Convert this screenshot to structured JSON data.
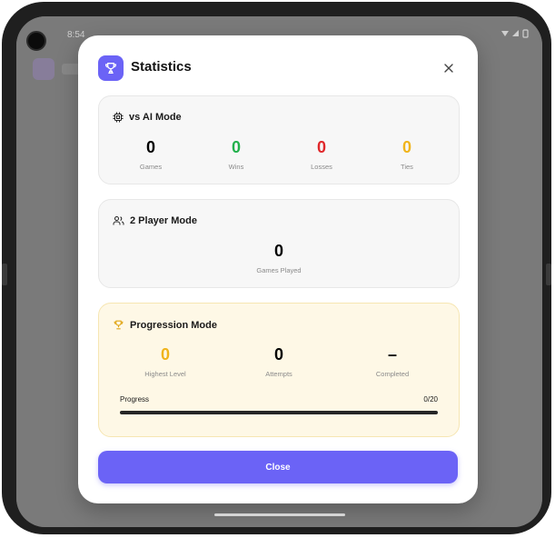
{
  "status_bar": {
    "time": "8:54",
    "icons": "▾ ▮"
  },
  "dialog": {
    "title": "Statistics",
    "close_button_label": "Close"
  },
  "vs_ai": {
    "title": "vs AI Mode",
    "stats": [
      {
        "value": "0",
        "label": "Games",
        "color": "#111111"
      },
      {
        "value": "0",
        "label": "Wins",
        "color": "#22b14c"
      },
      {
        "value": "0",
        "label": "Losses",
        "color": "#e0282b"
      },
      {
        "value": "0",
        "label": "Ties",
        "color": "#f0b41b"
      }
    ]
  },
  "two_player": {
    "title": "2 Player Mode",
    "stats": [
      {
        "value": "0",
        "label": "Games Played",
        "color": "#111111"
      }
    ]
  },
  "progression": {
    "title": "Progression Mode",
    "stats": [
      {
        "value": "0",
        "label": "Highest Level",
        "color": "#f0b41b"
      },
      {
        "value": "0",
        "label": "Attempts",
        "color": "#111111"
      },
      {
        "value": "–",
        "label": "Completed",
        "color": "#111111"
      }
    ],
    "progress_label": "Progress",
    "progress_count": "0/20",
    "progress_fraction": 0
  },
  "colors": {
    "accent": "#6b63f6",
    "win": "#22b14c",
    "loss": "#e0282b",
    "tie": "#f0b41b"
  }
}
